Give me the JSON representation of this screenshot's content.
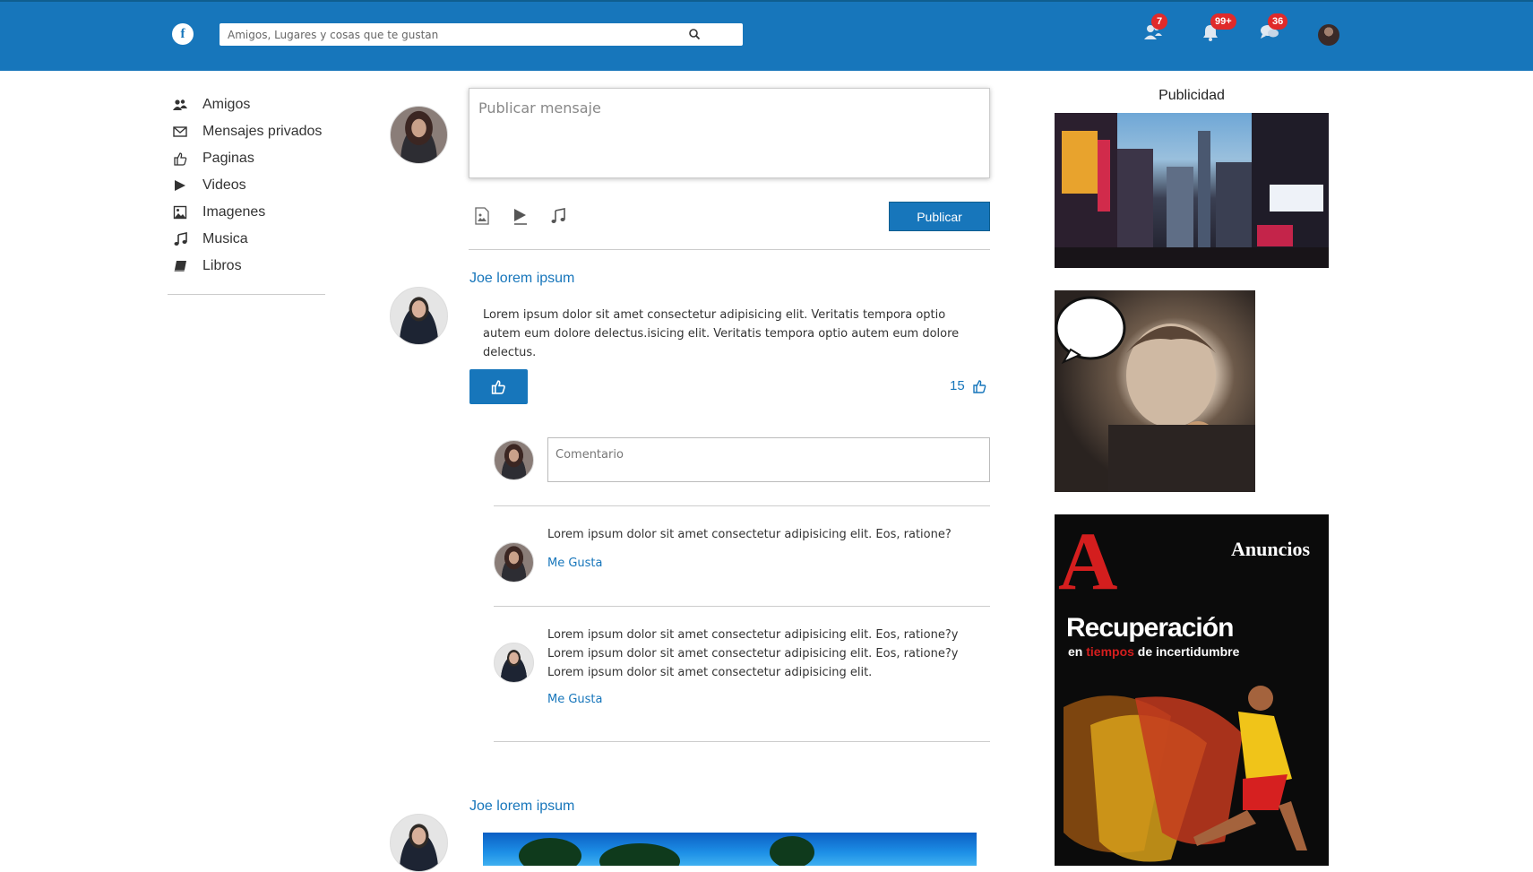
{
  "header": {
    "logo_letter": "f",
    "search_placeholder": "Amigos, Lugares y cosas que te gustan",
    "badges": {
      "friends": "7",
      "notifications": "99+",
      "messages": "36"
    }
  },
  "sidebar": {
    "items": [
      {
        "label": "Amigos",
        "icon": "users-icon"
      },
      {
        "label": "Mensajes privados",
        "icon": "envelope-icon"
      },
      {
        "label": "Paginas",
        "icon": "thumbs-up-icon"
      },
      {
        "label": "Videos",
        "icon": "play-icon"
      },
      {
        "label": "Imagenes",
        "icon": "image-icon"
      },
      {
        "label": "Musica",
        "icon": "music-icon"
      },
      {
        "label": "Libros",
        "icon": "book-icon"
      }
    ]
  },
  "composer": {
    "placeholder": "Publicar mensaje",
    "publish_label": "Publicar"
  },
  "posts": [
    {
      "author": "Joe lorem ipsum",
      "text": "Lorem ipsum dolor sit amet consectetur adipisicing elit. Veritatis tempora optio autem eum dolore delectus.isicing elit. Veritatis tempora optio autem eum dolore delectus.",
      "like_count": "15",
      "comment_placeholder": "Comentario",
      "comments": [
        {
          "text": "Lorem ipsum dolor sit amet consectetur adipisicing elit. Eos, ratione?",
          "like_label": "Me Gusta"
        },
        {
          "text": "Lorem ipsum dolor sit amet consectetur adipisicing elit. Eos, ratione?y Lorem ipsum dolor sit amet consectetur adipisicing elit. Eos, ratione?y Lorem ipsum dolor sit amet consectetur adipisicing elit.",
          "like_label": "Me Gusta"
        }
      ]
    },
    {
      "author": "Joe lorem ipsum"
    }
  ],
  "ads": {
    "title": "Publicidad",
    "magazine": {
      "letter": "A",
      "brand": "Anuncios",
      "headline": "Recuperación",
      "sub_before": "en ",
      "sub_red": "tiempos",
      "sub_after": " de incertidumbre"
    }
  },
  "colors": {
    "brand_blue": "#1776bb",
    "badge_red": "#e02a2a"
  }
}
